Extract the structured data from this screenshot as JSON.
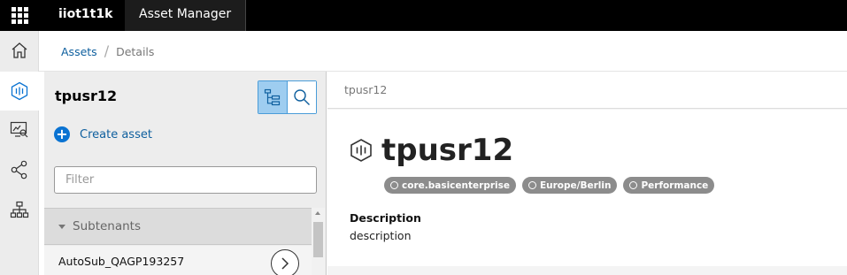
{
  "header": {
    "tenant": "iiot1t1k",
    "app_title": "Asset Manager"
  },
  "nav": {
    "items": [
      {
        "name": "home-icon",
        "active": false
      },
      {
        "name": "asset-icon",
        "active": true
      },
      {
        "name": "monitor-icon",
        "active": false
      },
      {
        "name": "share-icon",
        "active": false
      },
      {
        "name": "hierarchy-icon",
        "active": false
      }
    ]
  },
  "breadcrumb": {
    "assets": "Assets",
    "details": "Details"
  },
  "tree": {
    "title": "tpusr12",
    "create_label": "Create asset",
    "filter_placeholder": "Filter",
    "filter_value": "",
    "subtenants_label": "Subtenants",
    "rows": [
      {
        "label": "AutoSub_QAGP193257"
      }
    ]
  },
  "detail": {
    "header": "tpusr12",
    "name": "tpusr12",
    "chips": [
      "core.basicenterprise",
      "Europe/Berlin",
      "Performance"
    ],
    "description_label": "Description",
    "description_value": "description"
  },
  "colors": {
    "accent": "#0a73d2",
    "link": "#0e5f9e",
    "topbar": "#000000",
    "chip": "#8c8c8c",
    "toggle_active": "#9ecdf0"
  }
}
